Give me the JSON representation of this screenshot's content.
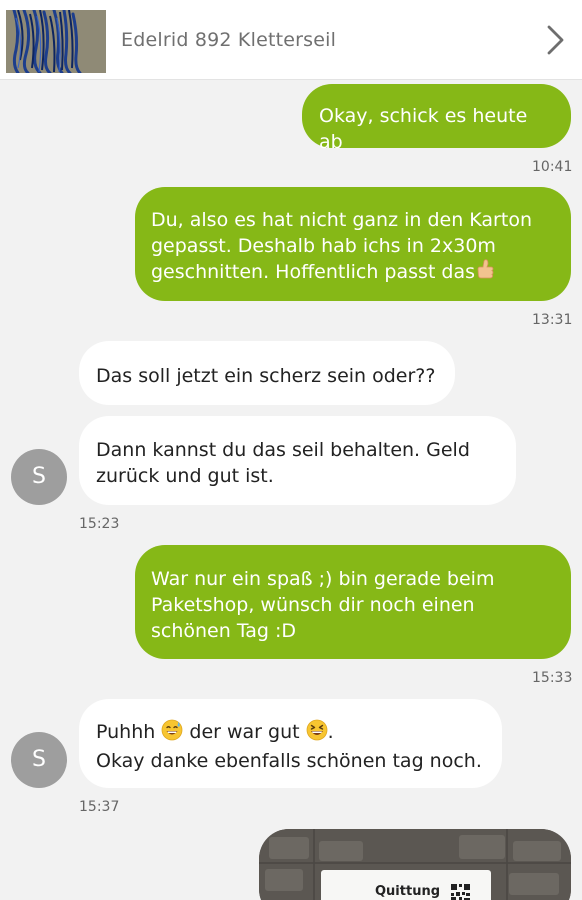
{
  "header": {
    "title": "Edelrid 892 Kletterseil",
    "thumbnail_icon": "rope-product-thumbnail",
    "chevron_icon": "chevron-right-icon"
  },
  "colors": {
    "outgoing_bubble": "#86b817",
    "incoming_bubble": "#ffffff",
    "background": "#f2f2f2",
    "avatar": "#9e9e9e"
  },
  "messages": [
    {
      "direction": "outgoing",
      "lines": [
        "Okay, schick es heute ab"
      ],
      "time": "10:41"
    },
    {
      "direction": "outgoing",
      "lines": [
        "Du, also es hat nicht ganz in den Karton",
        "gepasst. Deshalb hab ichs in 2x30m",
        "geschnitten. Hoffentlich passt das"
      ],
      "emoji": "thumbs-up-emoji",
      "time": "13:31"
    },
    {
      "direction": "incoming",
      "lines": [
        "Das soll jetzt ein scherz sein oder??"
      ]
    },
    {
      "direction": "incoming",
      "lines": [
        "Dann kannst du das seil behalten. Geld",
        "zurück und gut ist."
      ],
      "avatar": "S",
      "time": "15:23"
    },
    {
      "direction": "outgoing",
      "lines": [
        "War nur ein spaß ;) bin gerade beim",
        "Paketshop, wünsch dir noch einen",
        "schönen Tag :D"
      ],
      "time": "15:33"
    },
    {
      "direction": "incoming",
      "lines": [
        "Puhhh",
        "der war gut",
        ".",
        "Okay danke ebenfalls schönen tag noch."
      ],
      "emoji": [
        "sweat-smile-emoji",
        "grinning-squint-emoji"
      ],
      "avatar": "S",
      "time": "15:37"
    },
    {
      "direction": "outgoing",
      "type": "image",
      "caption": "Quittung"
    }
  ]
}
